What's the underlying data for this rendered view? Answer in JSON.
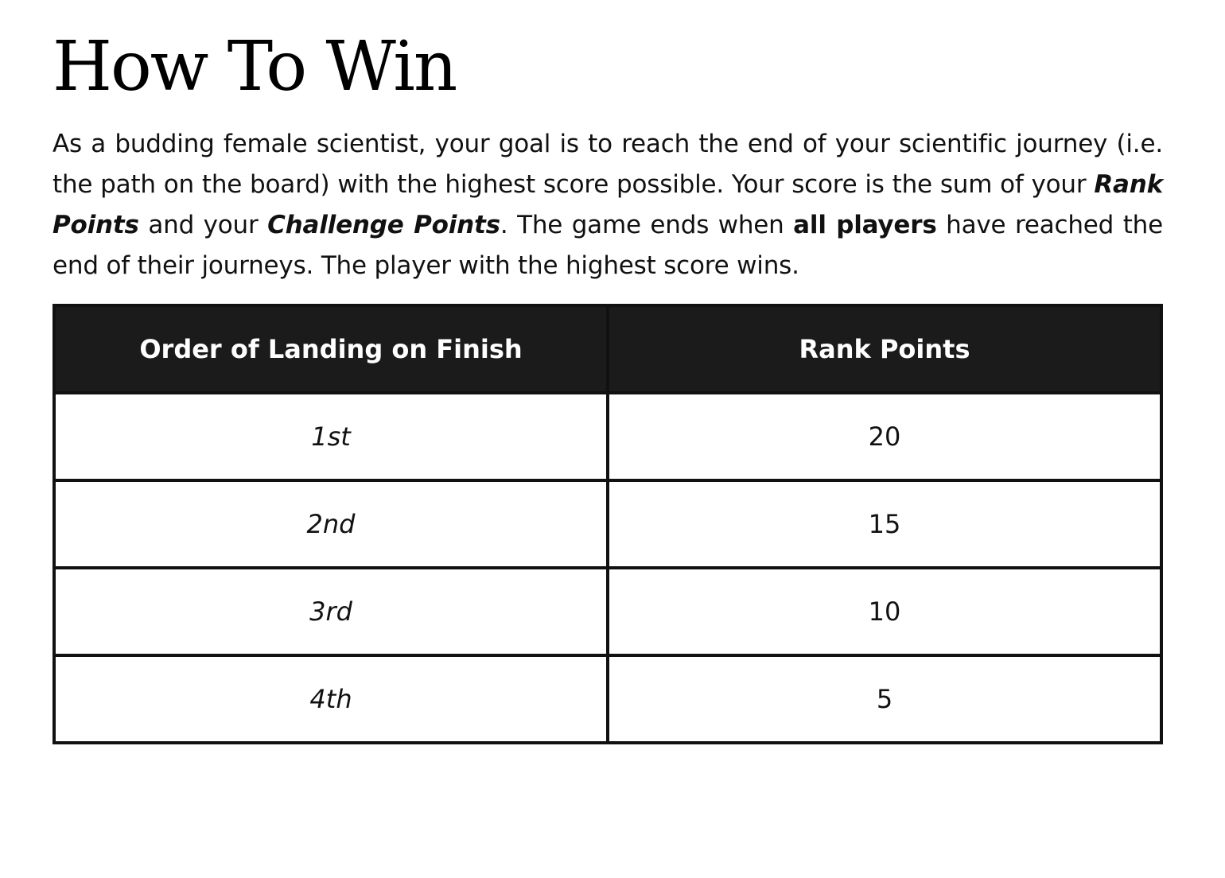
{
  "title": "How To Win",
  "intro": {
    "part1": "As a budding female scientist, your goal is to reach the end of your scientific journey (i.e. the path on the board) with the highest score possible. Your score is the sum of your ",
    "rank_points": "Rank Points",
    "part2": " and your ",
    "challenge_points": "Challenge Points",
    "part3": ". The game ends when ",
    "all_players": "all players",
    "part4": " have reached the end of their journeys. The player with the highest score wins."
  },
  "table": {
    "headers": [
      "Order of Landing on Finish",
      "Rank Points"
    ],
    "rows": [
      {
        "order": "1st",
        "points": "20"
      },
      {
        "order": "2nd",
        "points": "15"
      },
      {
        "order": "3rd",
        "points": "10"
      },
      {
        "order": "4th",
        "points": "5"
      }
    ]
  },
  "colors": {
    "header_bg": "#1b1b1b",
    "header_text": "#ffffff",
    "border": "#111111"
  }
}
